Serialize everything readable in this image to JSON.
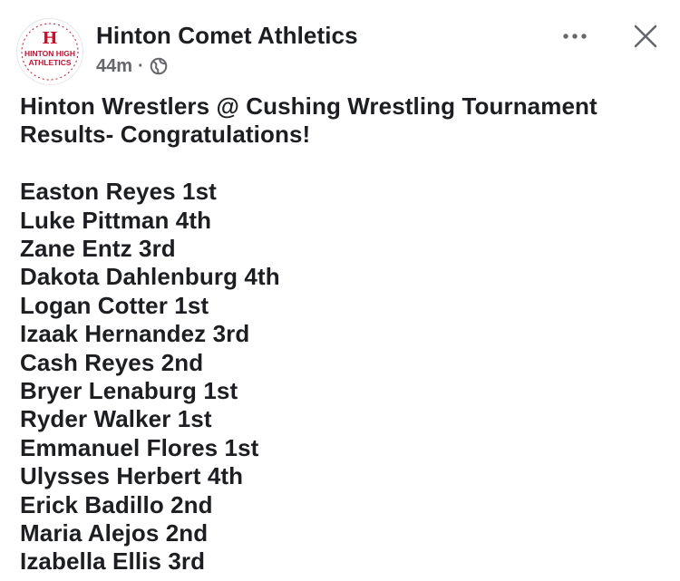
{
  "post": {
    "page_name": "Hinton Comet Athletics",
    "time": "44m",
    "separator": "·",
    "privacy_icon": "globe-icon",
    "avatar_text": {
      "letter": "H",
      "line1": "HINTON HIGH",
      "line2": "ATHLETICS"
    },
    "more_icon": "more-horizontal-icon",
    "close_icon": "close-icon",
    "headline_line1": "Hinton Wrestlers @ Cushing Wrestling Tournament",
    "headline_line2": "Results- Congratulations!",
    "results": [
      "Easton Reyes 1st",
      "Luke Pittman 4th",
      "Zane Entz 3rd",
      "Dakota Dahlenburg 4th",
      "Logan Cotter 1st",
      "Izaak Hernandez 3rd",
      "Cash Reyes 2nd",
      "Bryer Lenaburg 1st",
      "Ryder Walker 1st",
      "Emmanuel Flores 1st",
      "Ulysses Herbert 4th",
      "Erick Badillo 2nd",
      "Maria Alejos 2nd",
      "Izabella Ellis 3rd"
    ]
  },
  "colors": {
    "brand_red": "#c8102e",
    "text_primary": "#1c1e21",
    "text_secondary": "#65676b"
  }
}
